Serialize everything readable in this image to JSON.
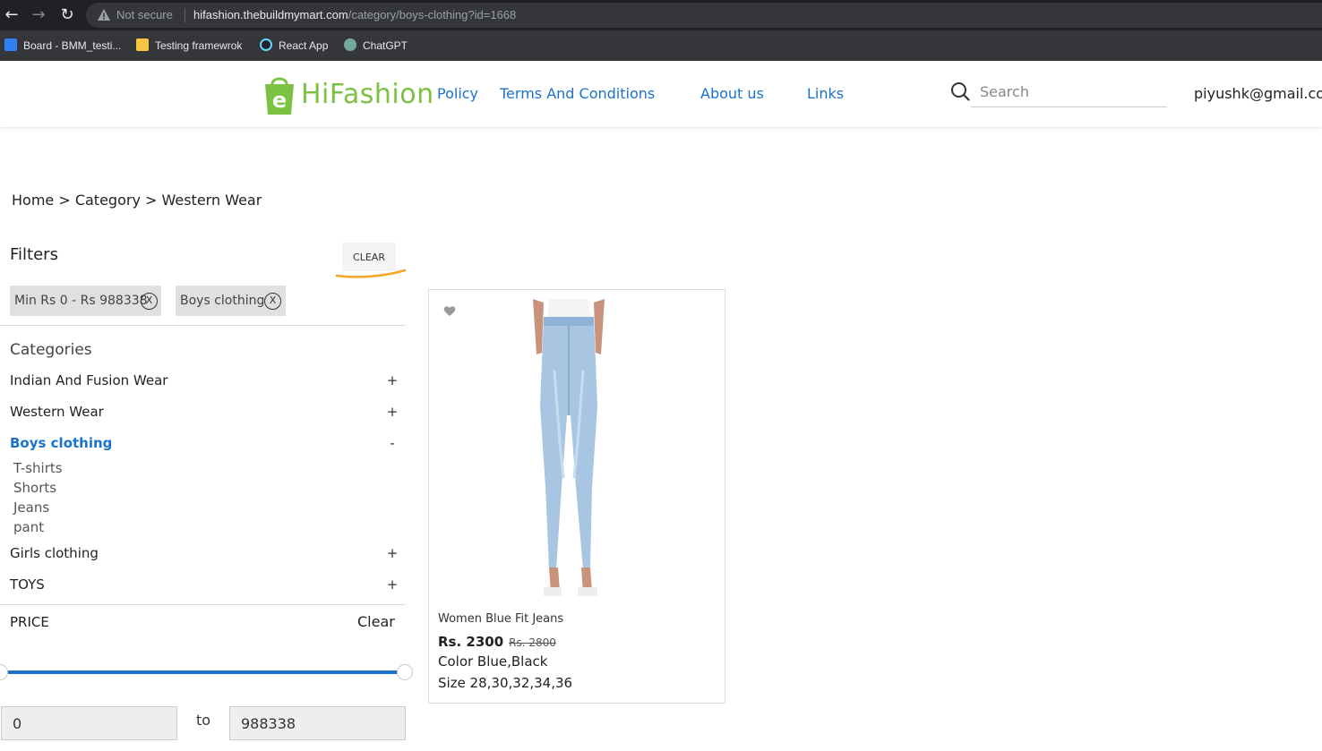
{
  "browser": {
    "not_secure": "Not secure",
    "url_host": "hifashion.thebuildmymart.com",
    "url_path": "/category/boys-clothing?id=1668",
    "bookmarks": [
      {
        "label": "Board - BMM_testi...",
        "color": "#2f7ff0"
      },
      {
        "label": "Testing framewrok",
        "color": "#f4c542"
      },
      {
        "label": "React App",
        "color": "#61dafb"
      },
      {
        "label": "ChatGPT",
        "color": "#74aa9c"
      }
    ]
  },
  "header": {
    "logo_text": "HiFashion",
    "nav": [
      "Policy",
      "Terms And Conditions",
      "About us",
      "Links"
    ],
    "search_placeholder": "Search",
    "user_email": "piyushk@gmail.co"
  },
  "breadcrumb": "Home > Category > Western Wear",
  "filters": {
    "title": "Filters",
    "clear_label": "CLEAR",
    "chips": [
      "Min Rs 0 - Rs 988338",
      "Boys clothing"
    ],
    "chip_close": "X",
    "categories_heading": "Categories",
    "categories": [
      {
        "label": "Indian And Fusion Wear",
        "toggle": "+"
      },
      {
        "label": "Western Wear",
        "toggle": "+"
      },
      {
        "label": "Boys clothing",
        "toggle": "-",
        "active": true,
        "children": [
          "T-shirts",
          "Shorts",
          "Jeans",
          "pant"
        ]
      },
      {
        "label": "Girls clothing",
        "toggle": "+"
      },
      {
        "label": "TOYS",
        "toggle": "+"
      }
    ],
    "price_title": "PRICE",
    "price_clear": "Clear",
    "price_range": {
      "min": 0,
      "max": 988338,
      "selected_min_fraction": 0.0,
      "selected_max_fraction": 1.0
    },
    "price_min_value": "0",
    "price_to": "to",
    "price_max_value": "988338"
  },
  "product": {
    "name": "Women Blue Fit Jeans",
    "price": "Rs. 2300",
    "old_price": "Rs. 2800",
    "color": "Color Blue,Black",
    "size": "Size 28,30,32,34,36"
  },
  "colors": {
    "accent": "#1a73c8",
    "brand_green": "#7cc242",
    "annotation_orange": "#f5a623"
  }
}
